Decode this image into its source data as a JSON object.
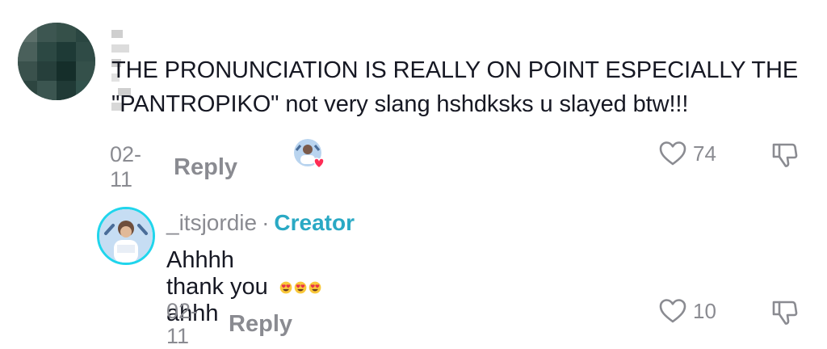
{
  "comment": {
    "username": "",
    "text_line1": "THE PRONUNCIATION IS REALLY ON POINT ESPECIALLY THE",
    "text_line2": "\"PANTROPIKO\" not very slang hshdksks u slayed btw!!!",
    "date": "02-11",
    "reply_label": "Reply",
    "likes": "74",
    "liked_by_creator": true
  },
  "reply": {
    "username": "_itsjordie",
    "separator": "·",
    "badge": "Creator",
    "text": "Ahhhh thank you ahhh",
    "emojis": [
      "heart-eyes-emoji",
      "heart-eyes-emoji",
      "heart-eyes-emoji"
    ],
    "date": "02-11",
    "reply_label": "Reply",
    "likes": "10"
  },
  "colors": {
    "text": "#161823",
    "muted": "#8a8b91",
    "creator": "#2aa9c4",
    "avatar_ring": "#20d5ec",
    "heart": "#fe2c55"
  },
  "icons": {
    "like": "heart-outline-icon",
    "dislike": "thumbs-down-icon"
  }
}
